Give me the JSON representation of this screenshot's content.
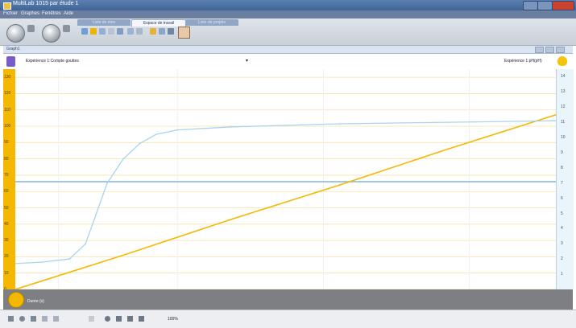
{
  "window": {
    "title": "MultiLab  1015 par  étude 1"
  },
  "menu": [
    "Fichier",
    "Graphes",
    "Fenêtres",
    "Aide"
  ],
  "tabs": [
    {
      "label": "Liste de mes",
      "active": false
    },
    {
      "label": "Espace de travail",
      "active": true
    },
    {
      "label": "Liste de projets",
      "active": false
    }
  ],
  "panel": {
    "title": "Graph1",
    "left_series": "Expérience 1:Compte gouttes",
    "right_series": "Expérience 1:pH(pH)",
    "x_axis_label": "Durée (s)"
  },
  "colors": {
    "left_axis": "#f5b800",
    "right_axis": "#7cc0e8",
    "series_left": "#f5b800",
    "series_right": "#a9d3ee",
    "cursor": "#9ec9e6"
  },
  "chart_data": {
    "type": "line",
    "left_axis": {
      "ticks": [
        "0",
        "10",
        "20",
        "30",
        "40",
        "50",
        "60",
        "70",
        "80",
        "90",
        "100",
        "110",
        "120",
        "130"
      ]
    },
    "right_axis": {
      "ticks": [
        "1",
        "2",
        "3",
        "4",
        "5",
        "6",
        "7",
        "8",
        "9",
        "10",
        "11",
        "12",
        "13",
        "14"
      ]
    },
    "cursor_y_left": 66,
    "series": [
      {
        "axis": "left",
        "x": [
          0,
          20,
          40,
          60,
          80,
          100
        ],
        "y": [
          0,
          21,
          43,
          64,
          86,
          107
        ]
      },
      {
        "axis": "right",
        "x": [
          0,
          5,
          10,
          13,
          15,
          17,
          20,
          23,
          26,
          30,
          40,
          60,
          80,
          100
        ],
        "y": [
          1.7,
          1.8,
          2.0,
          3.0,
          5.0,
          7.0,
          8.6,
          9.6,
          10.2,
          10.5,
          10.7,
          10.9,
          11.0,
          11.1
        ]
      }
    ]
  },
  "bottom": {
    "zoom_text": "100%"
  }
}
